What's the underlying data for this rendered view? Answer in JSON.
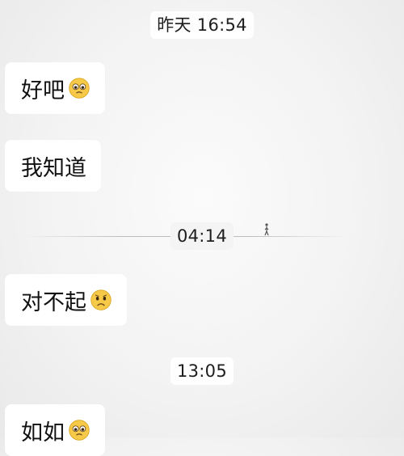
{
  "timestamps": [
    "昨天 16:54",
    "04:14",
    "13:05"
  ],
  "messages": [
    {
      "text": "好吧",
      "emoji": "pleading-face-icon"
    },
    {
      "text": "我知道",
      "emoji": ""
    },
    {
      "text": "对不起",
      "emoji": "frowning-face-icon"
    },
    {
      "text": "如如",
      "emoji": "pleading-face-icon"
    }
  ],
  "colors": {
    "bubble": "#ffffff",
    "text": "#111111",
    "background": "#f3f3f3",
    "emoji_face": "#f7c948"
  }
}
